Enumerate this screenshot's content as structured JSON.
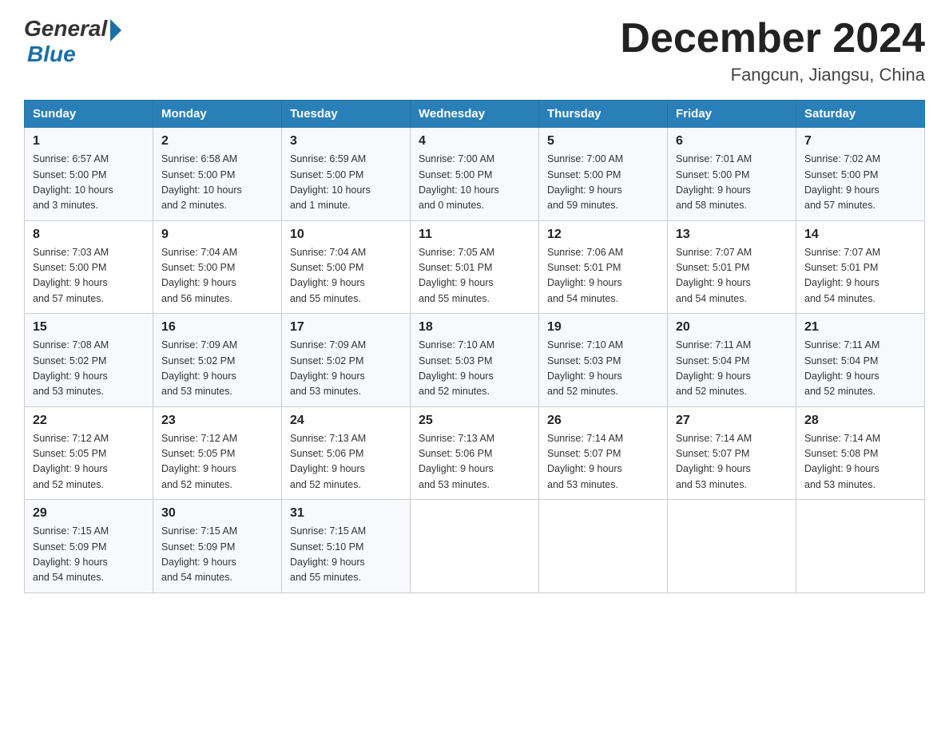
{
  "logo": {
    "general": "General",
    "arrow": "▶",
    "blue": "Blue"
  },
  "title": "December 2024",
  "subtitle": "Fangcun, Jiangsu, China",
  "days_of_week": [
    "Sunday",
    "Monday",
    "Tuesday",
    "Wednesday",
    "Thursday",
    "Friday",
    "Saturday"
  ],
  "weeks": [
    [
      {
        "day": "1",
        "sunrise": "6:57 AM",
        "sunset": "5:00 PM",
        "daylight": "10 hours and 3 minutes."
      },
      {
        "day": "2",
        "sunrise": "6:58 AM",
        "sunset": "5:00 PM",
        "daylight": "10 hours and 2 minutes."
      },
      {
        "day": "3",
        "sunrise": "6:59 AM",
        "sunset": "5:00 PM",
        "daylight": "10 hours and 1 minute."
      },
      {
        "day": "4",
        "sunrise": "7:00 AM",
        "sunset": "5:00 PM",
        "daylight": "10 hours and 0 minutes."
      },
      {
        "day": "5",
        "sunrise": "7:00 AM",
        "sunset": "5:00 PM",
        "daylight": "9 hours and 59 minutes."
      },
      {
        "day": "6",
        "sunrise": "7:01 AM",
        "sunset": "5:00 PM",
        "daylight": "9 hours and 58 minutes."
      },
      {
        "day": "7",
        "sunrise": "7:02 AM",
        "sunset": "5:00 PM",
        "daylight": "9 hours and 57 minutes."
      }
    ],
    [
      {
        "day": "8",
        "sunrise": "7:03 AM",
        "sunset": "5:00 PM",
        "daylight": "9 hours and 57 minutes."
      },
      {
        "day": "9",
        "sunrise": "7:04 AM",
        "sunset": "5:00 PM",
        "daylight": "9 hours and 56 minutes."
      },
      {
        "day": "10",
        "sunrise": "7:04 AM",
        "sunset": "5:00 PM",
        "daylight": "9 hours and 55 minutes."
      },
      {
        "day": "11",
        "sunrise": "7:05 AM",
        "sunset": "5:01 PM",
        "daylight": "9 hours and 55 minutes."
      },
      {
        "day": "12",
        "sunrise": "7:06 AM",
        "sunset": "5:01 PM",
        "daylight": "9 hours and 54 minutes."
      },
      {
        "day": "13",
        "sunrise": "7:07 AM",
        "sunset": "5:01 PM",
        "daylight": "9 hours and 54 minutes."
      },
      {
        "day": "14",
        "sunrise": "7:07 AM",
        "sunset": "5:01 PM",
        "daylight": "9 hours and 54 minutes."
      }
    ],
    [
      {
        "day": "15",
        "sunrise": "7:08 AM",
        "sunset": "5:02 PM",
        "daylight": "9 hours and 53 minutes."
      },
      {
        "day": "16",
        "sunrise": "7:09 AM",
        "sunset": "5:02 PM",
        "daylight": "9 hours and 53 minutes."
      },
      {
        "day": "17",
        "sunrise": "7:09 AM",
        "sunset": "5:02 PM",
        "daylight": "9 hours and 53 minutes."
      },
      {
        "day": "18",
        "sunrise": "7:10 AM",
        "sunset": "5:03 PM",
        "daylight": "9 hours and 52 minutes."
      },
      {
        "day": "19",
        "sunrise": "7:10 AM",
        "sunset": "5:03 PM",
        "daylight": "9 hours and 52 minutes."
      },
      {
        "day": "20",
        "sunrise": "7:11 AM",
        "sunset": "5:04 PM",
        "daylight": "9 hours and 52 minutes."
      },
      {
        "day": "21",
        "sunrise": "7:11 AM",
        "sunset": "5:04 PM",
        "daylight": "9 hours and 52 minutes."
      }
    ],
    [
      {
        "day": "22",
        "sunrise": "7:12 AM",
        "sunset": "5:05 PM",
        "daylight": "9 hours and 52 minutes."
      },
      {
        "day": "23",
        "sunrise": "7:12 AM",
        "sunset": "5:05 PM",
        "daylight": "9 hours and 52 minutes."
      },
      {
        "day": "24",
        "sunrise": "7:13 AM",
        "sunset": "5:06 PM",
        "daylight": "9 hours and 52 minutes."
      },
      {
        "day": "25",
        "sunrise": "7:13 AM",
        "sunset": "5:06 PM",
        "daylight": "9 hours and 53 minutes."
      },
      {
        "day": "26",
        "sunrise": "7:14 AM",
        "sunset": "5:07 PM",
        "daylight": "9 hours and 53 minutes."
      },
      {
        "day": "27",
        "sunrise": "7:14 AM",
        "sunset": "5:07 PM",
        "daylight": "9 hours and 53 minutes."
      },
      {
        "day": "28",
        "sunrise": "7:14 AM",
        "sunset": "5:08 PM",
        "daylight": "9 hours and 53 minutes."
      }
    ],
    [
      {
        "day": "29",
        "sunrise": "7:15 AM",
        "sunset": "5:09 PM",
        "daylight": "9 hours and 54 minutes."
      },
      {
        "day": "30",
        "sunrise": "7:15 AM",
        "sunset": "5:09 PM",
        "daylight": "9 hours and 54 minutes."
      },
      {
        "day": "31",
        "sunrise": "7:15 AM",
        "sunset": "5:10 PM",
        "daylight": "9 hours and 55 minutes."
      },
      null,
      null,
      null,
      null
    ]
  ],
  "labels": {
    "sunrise": "Sunrise:",
    "sunset": "Sunset:",
    "daylight": "Daylight:"
  }
}
